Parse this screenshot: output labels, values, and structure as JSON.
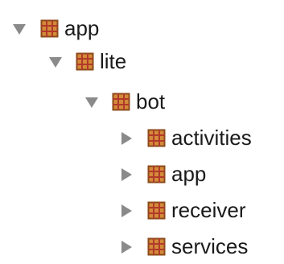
{
  "tree": {
    "nodes": [
      {
        "label": "app",
        "state": "expanded",
        "icon": "package-icon"
      },
      {
        "label": "lite",
        "state": "expanded",
        "icon": "package-icon"
      },
      {
        "label": "bot",
        "state": "expanded",
        "icon": "package-icon"
      },
      {
        "label": "activities",
        "state": "collapsed",
        "icon": "package-icon"
      },
      {
        "label": "app",
        "state": "collapsed",
        "icon": "package-icon"
      },
      {
        "label": "receiver",
        "state": "collapsed",
        "icon": "package-icon"
      },
      {
        "label": "services",
        "state": "collapsed",
        "icon": "package-icon"
      }
    ]
  },
  "colors": {
    "arrow": "#8a8a8a",
    "package_fill": "#d58a3a",
    "package_border": "#8b4a1a",
    "package_cross": "#b03a2a",
    "text": "#1a1a1a"
  }
}
